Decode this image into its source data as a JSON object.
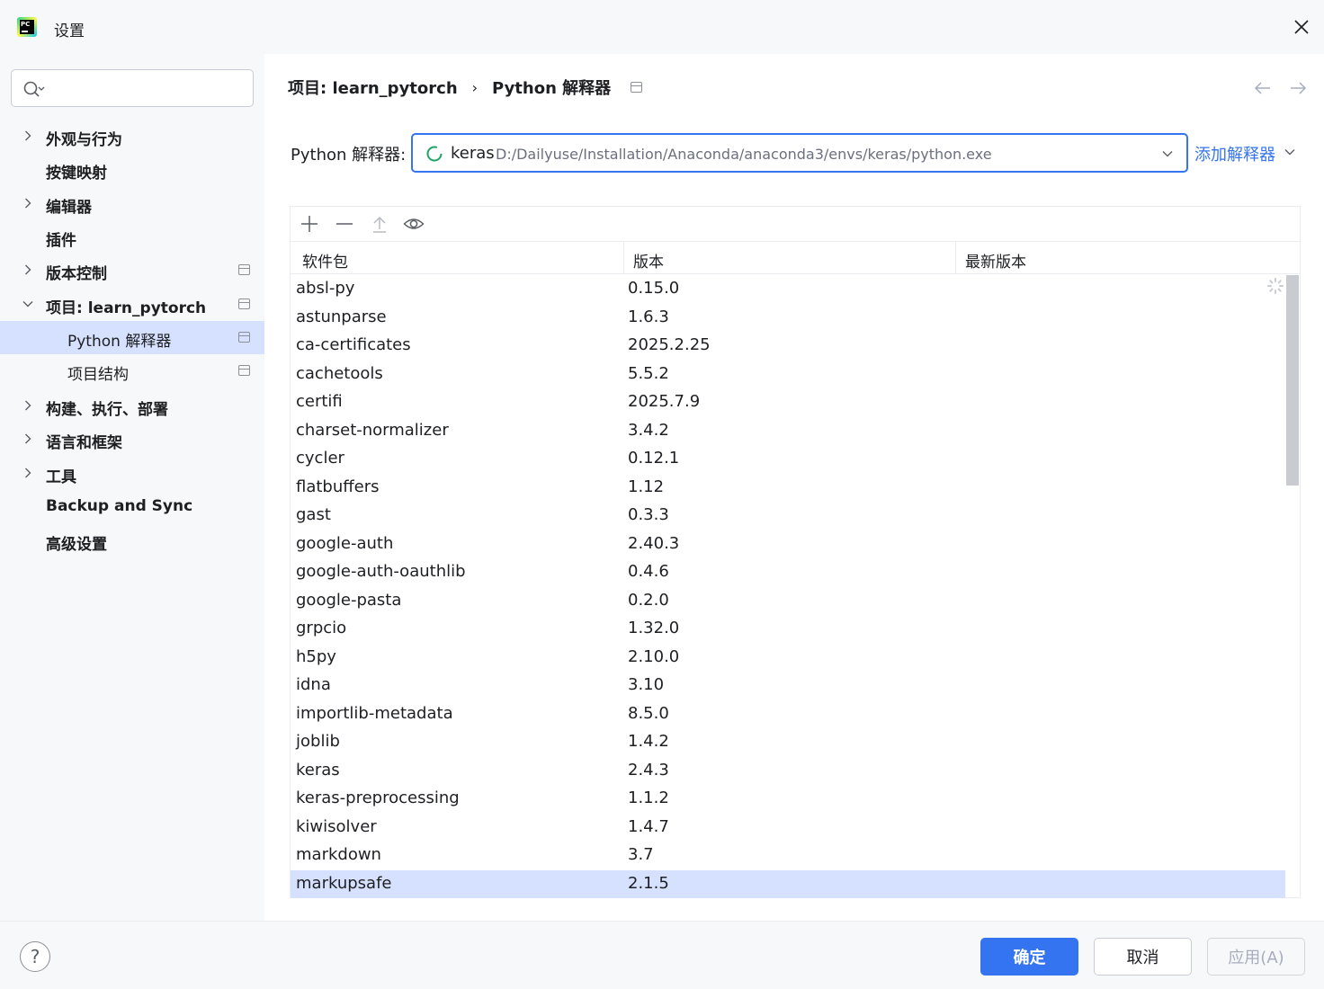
{
  "window": {
    "title": "设置"
  },
  "sidebar": {
    "search_placeholder": "",
    "items": [
      {
        "label": "外观与行为",
        "expandable": true,
        "level": 0
      },
      {
        "label": "按键映射",
        "expandable": false,
        "level": 0
      },
      {
        "label": "编辑器",
        "expandable": true,
        "level": 0
      },
      {
        "label": "插件",
        "expandable": false,
        "level": 0
      },
      {
        "label": "版本控制",
        "expandable": true,
        "level": 0
      },
      {
        "label": "项目: learn_pytorch",
        "expandable": true,
        "expanded": true,
        "level": 0
      },
      {
        "label": "Python 解释器",
        "level": 1,
        "selected": true
      },
      {
        "label": "项目结构",
        "level": 1
      },
      {
        "label": "构建、执行、部署",
        "expandable": true,
        "level": 0
      },
      {
        "label": "语言和框架",
        "expandable": true,
        "level": 0
      },
      {
        "label": "工具",
        "expandable": true,
        "level": 0
      },
      {
        "label": "Backup and Sync",
        "expandable": false,
        "level": 0
      },
      {
        "label": "高级设置",
        "expandable": false,
        "level": 0
      }
    ]
  },
  "breadcrumb": {
    "project": "项目: learn_pytorch",
    "separator": "›",
    "page": "Python 解释器"
  },
  "interpreter": {
    "label": "Python 解释器:",
    "name": "keras",
    "path": "D:/Dailyuse/Installation/Anaconda/anaconda3/envs/keras/python.exe",
    "add_label": "添加解释器"
  },
  "packages": {
    "columns": [
      "软件包",
      "版本",
      "最新版本"
    ],
    "rows": [
      {
        "name": "absl-py",
        "version": "0.15.0",
        "latest": ""
      },
      {
        "name": "astunparse",
        "version": "1.6.3",
        "latest": ""
      },
      {
        "name": "ca-certificates",
        "version": "2025.2.25",
        "latest": ""
      },
      {
        "name": "cachetools",
        "version": "5.5.2",
        "latest": ""
      },
      {
        "name": "certifi",
        "version": "2025.7.9",
        "latest": ""
      },
      {
        "name": "charset-normalizer",
        "version": "3.4.2",
        "latest": ""
      },
      {
        "name": "cycler",
        "version": "0.12.1",
        "latest": ""
      },
      {
        "name": "flatbuffers",
        "version": "1.12",
        "latest": ""
      },
      {
        "name": "gast",
        "version": "0.3.3",
        "latest": ""
      },
      {
        "name": "google-auth",
        "version": "2.40.3",
        "latest": ""
      },
      {
        "name": "google-auth-oauthlib",
        "version": "0.4.6",
        "latest": ""
      },
      {
        "name": "google-pasta",
        "version": "0.2.0",
        "latest": ""
      },
      {
        "name": "grpcio",
        "version": "1.32.0",
        "latest": ""
      },
      {
        "name": "h5py",
        "version": "2.10.0",
        "latest": ""
      },
      {
        "name": "idna",
        "version": "3.10",
        "latest": ""
      },
      {
        "name": "importlib-metadata",
        "version": "8.5.0",
        "latest": ""
      },
      {
        "name": "joblib",
        "version": "1.4.2",
        "latest": ""
      },
      {
        "name": "keras",
        "version": "2.4.3",
        "latest": ""
      },
      {
        "name": "keras-preprocessing",
        "version": "1.1.2",
        "latest": ""
      },
      {
        "name": "kiwisolver",
        "version": "1.4.7",
        "latest": ""
      },
      {
        "name": "markdown",
        "version": "3.7",
        "latest": ""
      },
      {
        "name": "markupsafe",
        "version": "2.1.5",
        "latest": "",
        "selected": true
      }
    ]
  },
  "footer": {
    "help": "?",
    "ok": "确定",
    "cancel": "取消",
    "apply": "应用(A)"
  },
  "colors": {
    "accent": "#3574f0",
    "selection": "#d5e1ff",
    "sidebar_bg": "#f7f8fa",
    "muted_text": "#6c707e"
  }
}
